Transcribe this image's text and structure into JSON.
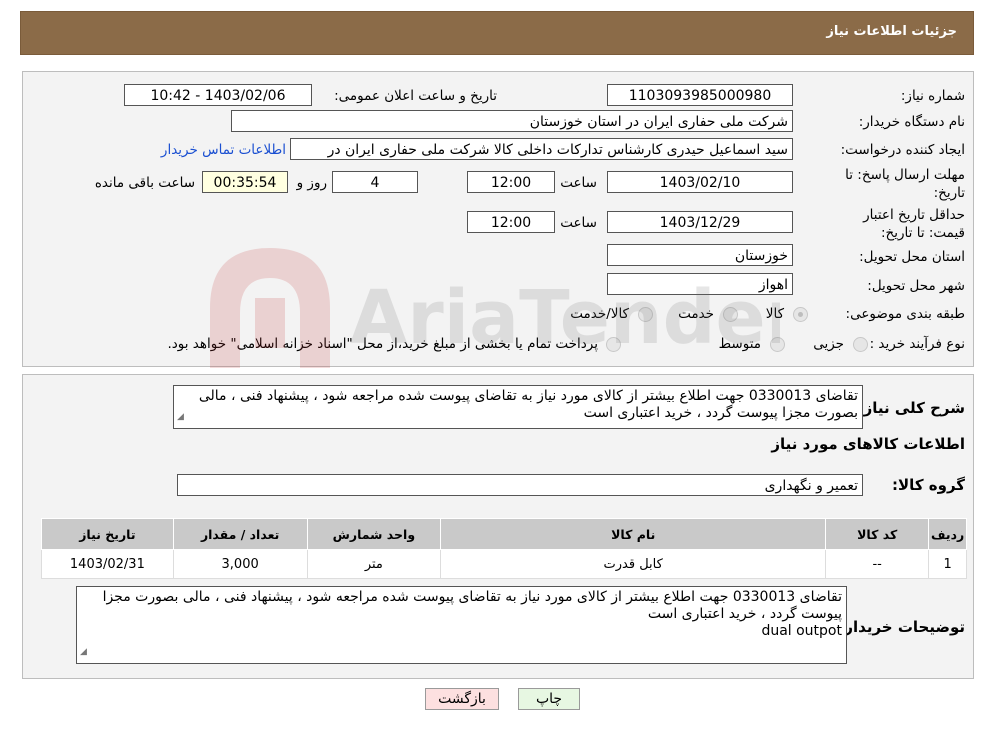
{
  "header": {
    "title": "جزئیات اطلاعات نیاز"
  },
  "form": {
    "need_number_label": "شماره نیاز:",
    "need_number": "1103093985000980",
    "announce_label": "تاریخ و ساعت اعلان عمومی:",
    "announce_value": "1403/02/06 - 10:42",
    "buyer_org_label": "نام دستگاه خریدار:",
    "buyer_org": "شرکت ملی حفاری ایران در استان خوزستان",
    "creator_label": "ایجاد کننده درخواست:",
    "creator": "سید اسماعیل حیدری کارشناس تدارکات داخلی کالا شرکت ملی حفاری ایران در",
    "contact_link": "اطلاعات تماس خریدار",
    "deadline_label": "مهلت ارسال پاسخ: تا تاریخ:",
    "deadline_date": "1403/02/10",
    "time_label": "ساعت",
    "deadline_time": "12:00",
    "days_value": "4",
    "days_label": "روز و",
    "remaining_time": "00:35:54",
    "remaining_label": "ساعت باقی مانده",
    "validity_label": "حداقل تاریخ اعتبار قیمت: تا تاریخ:",
    "validity_date": "1403/12/29",
    "validity_time": "12:00",
    "province_label": "استان محل تحویل:",
    "province": "خوزستان",
    "city_label": "شهر محل تحویل:",
    "city": "اهواز",
    "category_label": "طبقه بندی موضوعی:",
    "category_options": [
      "کالا",
      "خدمت",
      "کالا/خدمت"
    ],
    "process_label": "نوع فرآیند خرید :",
    "process_options": [
      "جزیی",
      "متوسط"
    ],
    "process_note": "پرداخت تمام یا بخشی از مبلغ خرید،از محل \"اسناد خزانه اسلامی\" خواهد بود."
  },
  "details": {
    "summary_label": "شرح کلی نیاز:",
    "summary_text": "تقاضای 0330013 جهت اطلاع بیشتر از کالای مورد نیاز به تقاضای پیوست شده مراجعه شود ، پیشنهاد فنی ، مالی بصورت مجزا پیوست گردد ، خرید اعتباری است",
    "goods_info_title": "اطلاعات کالاهای مورد نیاز",
    "goods_group_label": "گروه کالا:",
    "goods_group": "تعمیر و نگهداری",
    "table": {
      "headers": [
        "ردیف",
        "کد کالا",
        "نام کالا",
        "واحد شمارش",
        "تعداد / مقدار",
        "تاریخ نیاز"
      ],
      "rows": [
        [
          "1",
          "--",
          "کابل قدرت",
          "متر",
          "3,000",
          "1403/02/31"
        ]
      ]
    },
    "buyer_notes_label": "توضیحات خریدار:",
    "buyer_notes_line1": "تقاضای 0330013 جهت اطلاع بیشتر از کالای مورد نیاز به تقاضای پیوست شده مراجعه شود ، پیشنهاد فنی ، مالی بصورت مجزا پیوست گردد ، خرید اعتباری است",
    "buyer_notes_line2": "dual outpot"
  },
  "buttons": {
    "print": "چاپ",
    "back": "بازگشت"
  },
  "colors": {
    "header_bg": "#8b6b48",
    "panel_bg": "#f3f3f3",
    "back_button_bg": "#fde0e0",
    "print_button_bg": "#e7f7e2",
    "link": "#1a4fd1"
  },
  "watermark": "AriaTender.neT"
}
